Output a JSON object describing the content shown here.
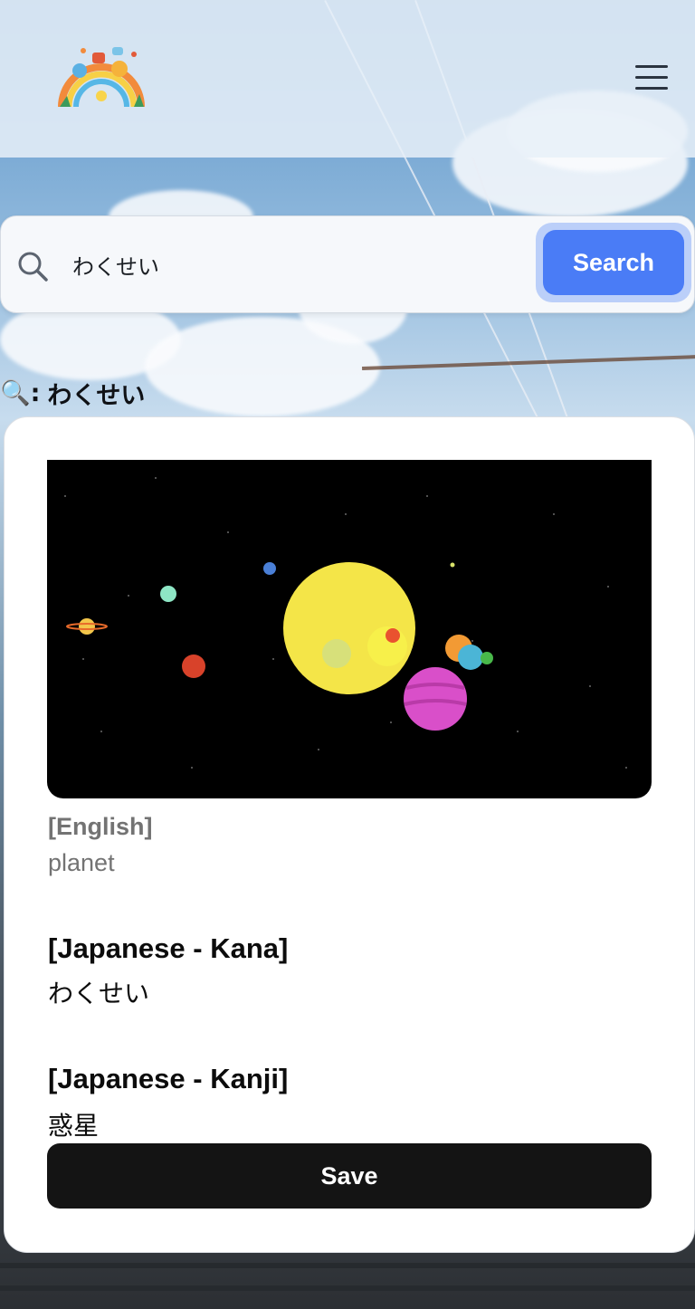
{
  "header": {
    "logo_icon": "rainbow-characters-logo-icon",
    "menu_icon": "hamburger-menu-icon"
  },
  "search": {
    "icon": "search-icon",
    "value": "わくせい",
    "button_label": "Search",
    "accent_color": "#4a7cf6"
  },
  "query": {
    "prefix_icon": "magnifier-icon",
    "prefix": "🔍:",
    "term": "わくせい"
  },
  "result": {
    "image_icon": "solar-system-illustration",
    "english_heading": "[English]",
    "english_value": "planet",
    "kana_heading": "[Japanese - Kana]",
    "kana_value": "わくせい",
    "kanji_heading": "[Japanese - Kanji]",
    "kanji_value": "惑星",
    "save_label": "Save"
  }
}
